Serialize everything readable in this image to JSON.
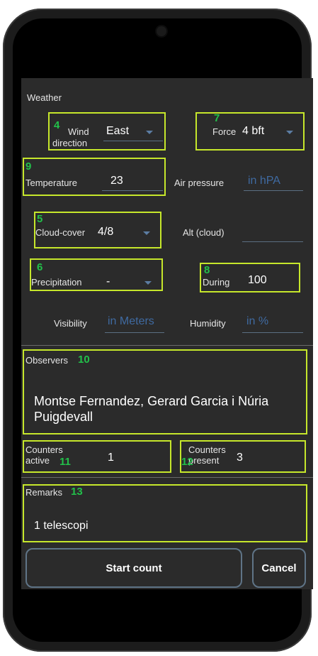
{
  "weather": {
    "section_label": "Weather",
    "wind_direction_label_1": "Wind",
    "wind_direction_label_2": "direction",
    "wind_direction_value": "East",
    "force_label": "Force",
    "force_value": "4 bft",
    "temperature_label": "Temperature",
    "temperature_value": "23",
    "air_pressure_label": "Air pressure",
    "air_pressure_placeholder": "in hPA",
    "cloud_cover_label": "Cloud-cover",
    "cloud_cover_value": "4/8",
    "alt_cloud_label": "Alt (cloud)",
    "alt_cloud_value": "",
    "precipitation_label": "Precipitation",
    "precipitation_value": "-",
    "during_label": "During",
    "during_value": "100",
    "visibility_label": "Visibility",
    "visibility_placeholder": "in Meters",
    "humidity_label": "Humidity",
    "humidity_placeholder": "in %"
  },
  "observers": {
    "label": "Observers",
    "value": "Montse Fernandez, Gerard Garcia i Núria Puigdevall"
  },
  "counters": {
    "active_label_1": "Counters",
    "active_label_2": "active",
    "active_value": "1",
    "present_label_1": "Counters",
    "present_label_2": "present",
    "present_value": "3"
  },
  "remarks": {
    "label": "Remarks",
    "value": "1 telescopi"
  },
  "buttons": {
    "start_label": "Start count",
    "cancel_label": "Cancel"
  },
  "annotations": {
    "n4": "4",
    "n5": "5",
    "n6": "6",
    "n7": "7",
    "n8": "8",
    "n9": "9",
    "n10": "10",
    "n11": "11",
    "n12": "12",
    "n13": "13"
  },
  "colors": {
    "highlight": "#c6e72b",
    "annotation_number": "#22c04a",
    "placeholder": "#3f6aa1",
    "background": "#2b2b2b"
  }
}
